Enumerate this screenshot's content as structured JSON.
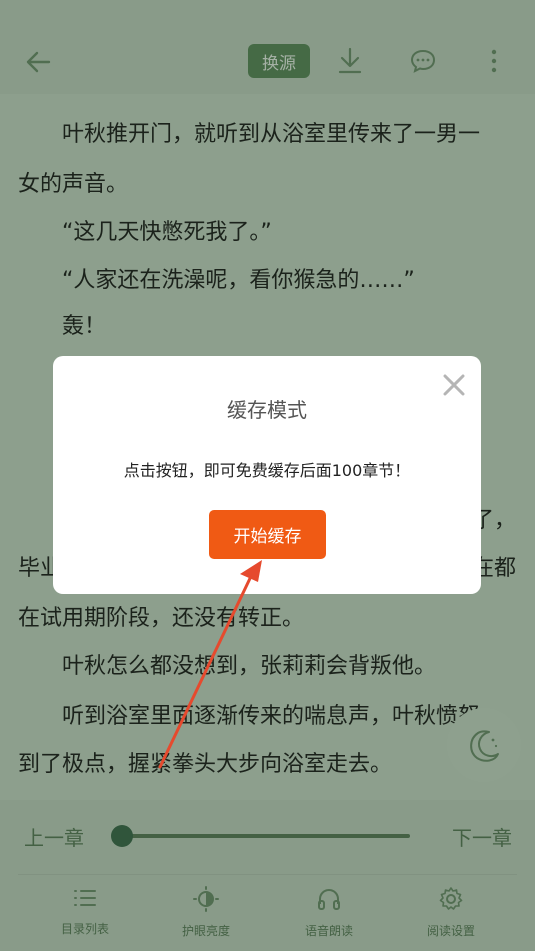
{
  "header": {
    "source_button": "换源",
    "icons": [
      "back-arrow-icon",
      "download-icon",
      "comment-icon",
      "more-vertical-icon"
    ]
  },
  "content": {
    "paragraphs": [
      "　　叶秋推开门，就听到从浴室里传来了一男一",
      "女的声音。",
      "　　“这几天快憋死我了。”",
      "　　“人家还在洗澡呢，看你猴急的……”",
      "　　轰！",
      "了，",
      "毕业",
      "在都",
      "在试用期阶段，还没有转正。",
      "　　叶秋怎么都没想到，张莉莉会背叛他。",
      "　　听到浴室里面逐渐传来的喘息声，叶秋愤怒",
      "到了极点，握紧拳头大步向浴室走去。"
    ]
  },
  "reader": {
    "prev_chapter": "上一章",
    "next_chapter": "下一章",
    "progress": 0.0
  },
  "tabs": [
    {
      "label": "目录列表",
      "icon": "list-icon"
    },
    {
      "label": "护眼亮度",
      "icon": "brightness-icon"
    },
    {
      "label": "语音朗读",
      "icon": "headphones-icon"
    },
    {
      "label": "阅读设置",
      "icon": "settings-icon"
    }
  ],
  "dialog": {
    "title": "缓存模式",
    "message": "点击按钮，即可免费缓存后面100章节！",
    "button": "开始缓存",
    "close_icon": "close-icon"
  },
  "colors": {
    "background": "#c7d7c7",
    "accent_green": "#5e8a5e",
    "button_orange": "#f05a14",
    "annotation_arrow": "#e64a2e"
  }
}
